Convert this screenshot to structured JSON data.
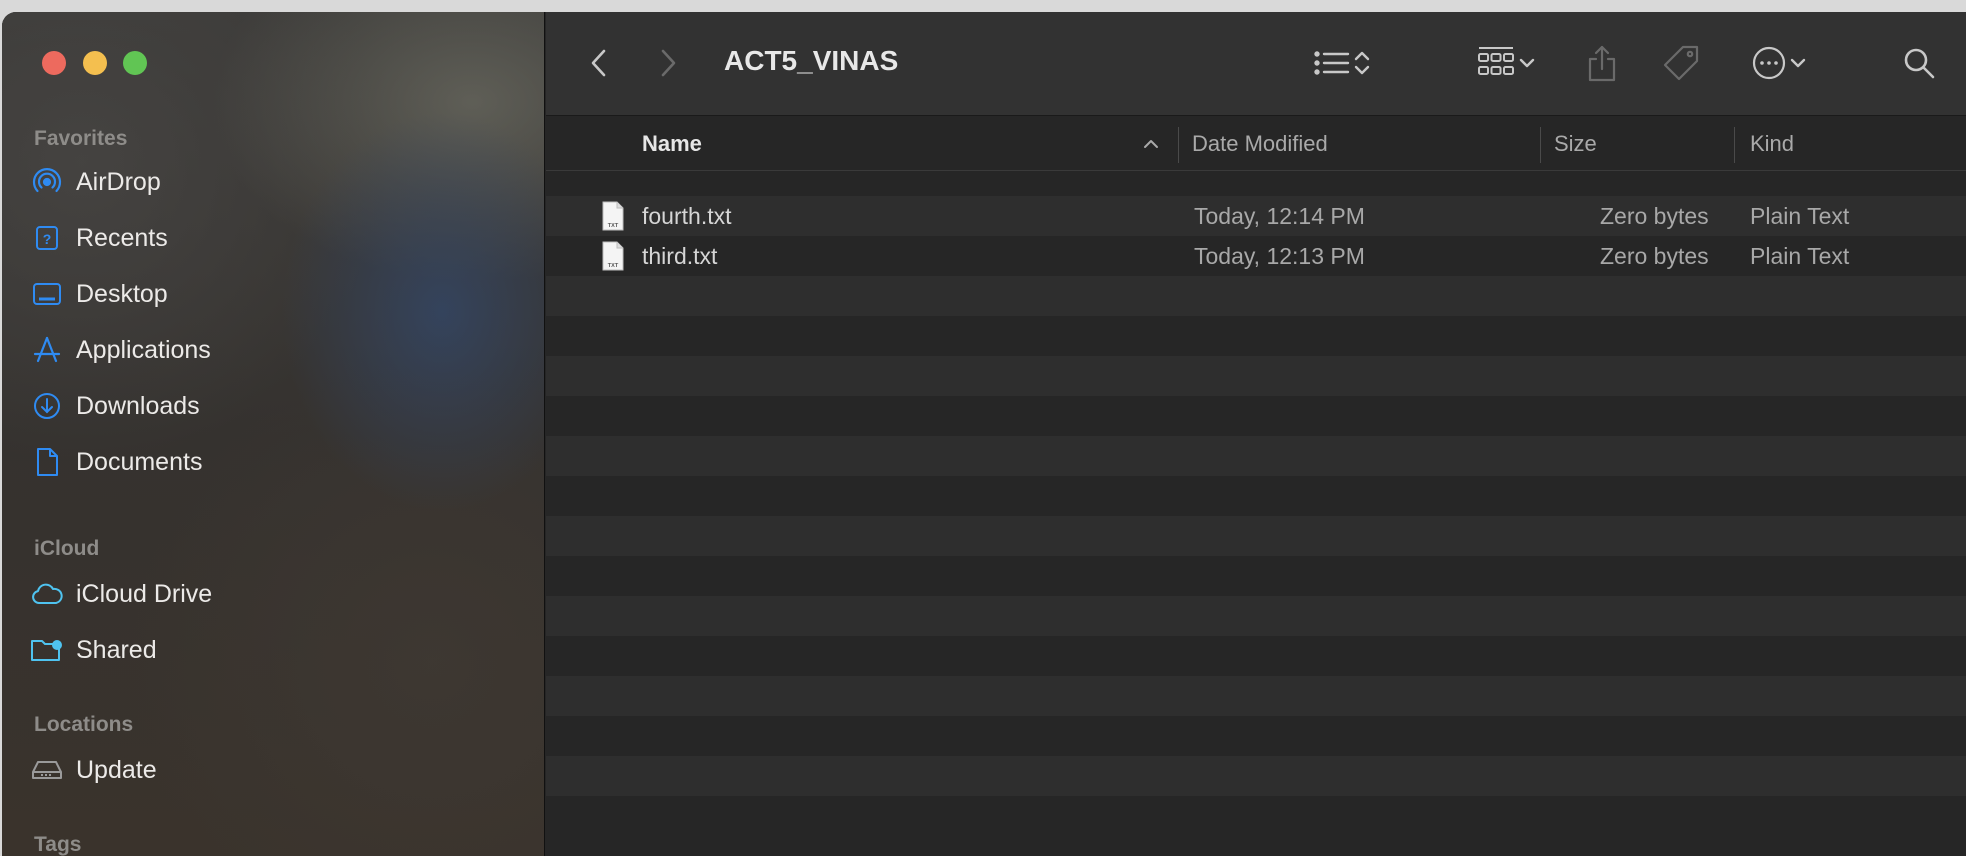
{
  "window": {
    "title": "ACT5_VINAS"
  },
  "sidebar": {
    "sections": [
      {
        "label": "Favorites",
        "items": [
          {
            "label": "AirDrop",
            "icon": "airdrop-icon"
          },
          {
            "label": "Recents",
            "icon": "recents-icon"
          },
          {
            "label": "Desktop",
            "icon": "desktop-icon"
          },
          {
            "label": "Applications",
            "icon": "applications-icon"
          },
          {
            "label": "Downloads",
            "icon": "downloads-icon"
          },
          {
            "label": "Documents",
            "icon": "documents-icon"
          }
        ]
      },
      {
        "label": "iCloud",
        "items": [
          {
            "label": "iCloud Drive",
            "icon": "icloud-icon"
          },
          {
            "label": "Shared",
            "icon": "shared-folder-icon"
          }
        ]
      },
      {
        "label": "Locations",
        "items": [
          {
            "label": "Update",
            "icon": "disk-icon"
          }
        ]
      },
      {
        "label": "Tags",
        "items": []
      }
    ]
  },
  "columns": {
    "name": "Name",
    "date_modified": "Date Modified",
    "size": "Size",
    "kind": "Kind",
    "sort": "name-ascending"
  },
  "files": [
    {
      "name": "fourth.txt",
      "date_modified": "Today, 12:14 PM",
      "size": "Zero bytes",
      "kind": "Plain Text",
      "icon_badge": "TXT"
    },
    {
      "name": "third.txt",
      "date_modified": "Today, 12:13 PM",
      "size": "Zero bytes",
      "kind": "Plain Text",
      "icon_badge": "TXT"
    }
  ],
  "colors": {
    "accent": "#2f8bf2",
    "icloud": "#4fc3f0",
    "background": "#262626"
  }
}
